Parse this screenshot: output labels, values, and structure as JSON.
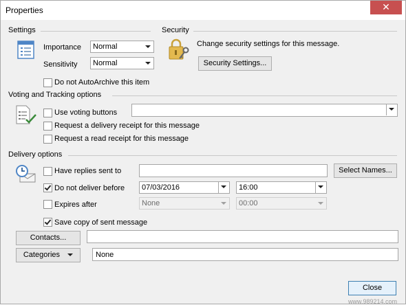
{
  "window": {
    "title": "Properties",
    "close_glyph": "✕"
  },
  "settings": {
    "section_label": "Settings",
    "importance_label": "Importance",
    "importance_value": "Normal",
    "sensitivity_label": "Sensitivity",
    "sensitivity_value": "Normal",
    "autoarchive_label": "Do not AutoArchive this item",
    "autoarchive_checked": false
  },
  "security": {
    "section_label": "Security",
    "description": "Change security settings for this message.",
    "button_label": "Security Settings..."
  },
  "voting": {
    "section_label": "Voting and Tracking options",
    "use_voting_label": "Use voting buttons",
    "voting_value": "",
    "delivery_receipt_label": "Request a delivery receipt for this message",
    "read_receipt_label": "Request a read receipt for this message"
  },
  "delivery": {
    "section_label": "Delivery options",
    "have_replies_label": "Have replies sent to",
    "have_replies_value": "",
    "select_names_label": "Select Names...",
    "do_not_deliver_label": "Do not deliver before",
    "do_not_deliver_checked": true,
    "deliver_date": "07/03/2016",
    "deliver_time": "16:00",
    "expires_label": "Expires after",
    "expires_date": "None",
    "expires_time": "00:00",
    "save_copy_label": "Save copy of sent message",
    "save_copy_checked": true
  },
  "contacts": {
    "button_label": "Contacts...",
    "value": ""
  },
  "categories": {
    "button_label": "Categories",
    "value": "None"
  },
  "footer": {
    "close_label": "Close"
  },
  "watermark": "www.989214.com",
  "colors": {
    "close_bg": "#c75050",
    "primary_border": "#3c7fb1",
    "dialog_bg": "#f0f0f0"
  }
}
